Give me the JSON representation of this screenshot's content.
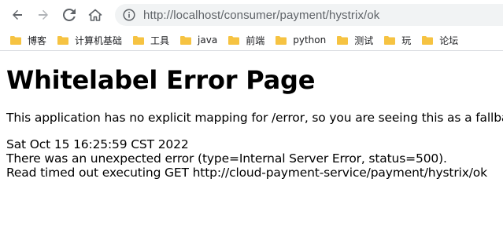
{
  "browser": {
    "url": "http://localhost/consumer/payment/hystrix/ok",
    "bookmarks": [
      {
        "label": "博客"
      },
      {
        "label": "计算机基础"
      },
      {
        "label": "工具"
      },
      {
        "label": "java"
      },
      {
        "label": "前端"
      },
      {
        "label": "python"
      },
      {
        "label": "测试"
      },
      {
        "label": "玩"
      },
      {
        "label": "论坛"
      }
    ],
    "icons": {
      "back": "arrow-left-icon",
      "forward": "arrow-right-icon",
      "reload": "reload-icon",
      "home": "home-icon",
      "site_info": "info-icon",
      "bookmark_folder": "folder-icon"
    },
    "colors": {
      "folder": "#f6c342",
      "url_text": "#5f6368",
      "omnibox_bg": "#f1f3f4"
    }
  },
  "page": {
    "title": "Whitelabel Error Page",
    "description": "This application has no explicit mapping for /error, so you are seeing this as a fallback.",
    "timestamp": "Sat Oct 15 16:25:59 CST 2022",
    "error_line": "There was an unexpected error (type=Internal Server Error, status=500).",
    "message": "Read timed out executing GET http://cloud-payment-service/payment/hystrix/ok"
  }
}
